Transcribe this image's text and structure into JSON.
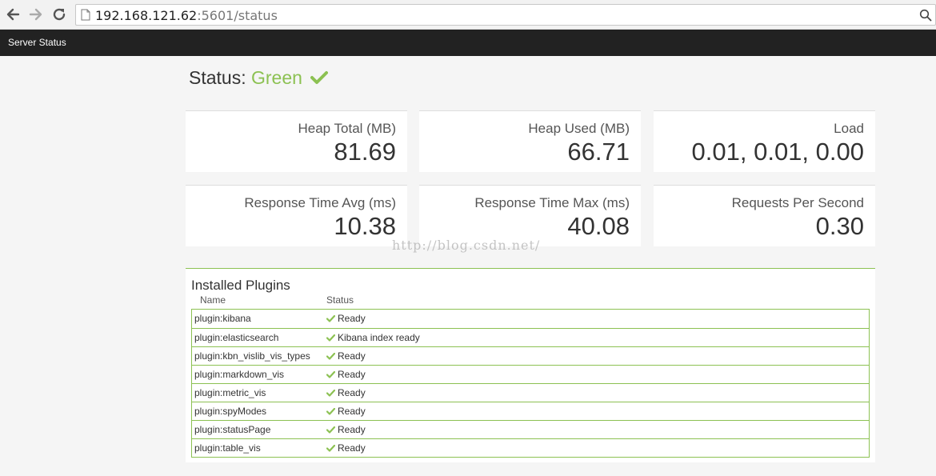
{
  "browser": {
    "url_host": "192.168.121.62",
    "url_rest": ":5601/status"
  },
  "topbar": {
    "title": "Server Status"
  },
  "status": {
    "prefix": "Status:",
    "state": "Green",
    "color": "#8cc152"
  },
  "metrics": [
    {
      "label": "Heap Total (MB)",
      "value": "81.69"
    },
    {
      "label": "Heap Used (MB)",
      "value": "66.71"
    },
    {
      "label": "Load",
      "value": "0.01, 0.01, 0.00"
    },
    {
      "label": "Response Time Avg (ms)",
      "value": "10.38"
    },
    {
      "label": "Response Time Max (ms)",
      "value": "40.08"
    },
    {
      "label": "Requests Per Second",
      "value": "0.30"
    }
  ],
  "watermark": "http://blog.csdn.net/",
  "plugins": {
    "title": "Installed Plugins",
    "columns": {
      "name": "Name",
      "status": "Status"
    },
    "rows": [
      {
        "name": "plugin:kibana",
        "status": "Ready"
      },
      {
        "name": "plugin:elasticsearch",
        "status": "Kibana index ready"
      },
      {
        "name": "plugin:kbn_vislib_vis_types",
        "status": "Ready"
      },
      {
        "name": "plugin:markdown_vis",
        "status": "Ready"
      },
      {
        "name": "plugin:metric_vis",
        "status": "Ready"
      },
      {
        "name": "plugin:spyModes",
        "status": "Ready"
      },
      {
        "name": "plugin:statusPage",
        "status": "Ready"
      },
      {
        "name": "plugin:table_vis",
        "status": "Ready"
      }
    ]
  },
  "icons": {
    "back": "back-arrow-icon",
    "forward": "forward-arrow-icon",
    "reload": "reload-icon",
    "page": "page-icon",
    "zoom": "magnifier-icon",
    "ok": "checkmark-icon"
  }
}
